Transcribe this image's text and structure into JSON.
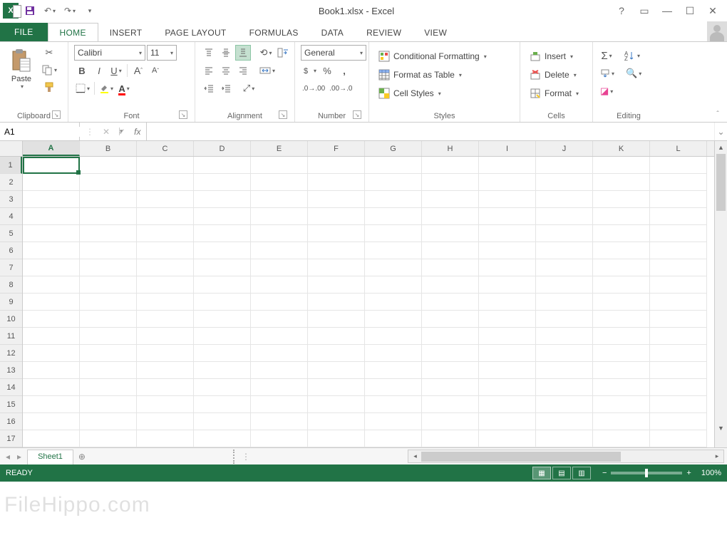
{
  "title": "Book1.xlsx - Excel",
  "tabs": {
    "file": "FILE",
    "home": "HOME",
    "insert": "INSERT",
    "pagelayout": "PAGE LAYOUT",
    "formulas": "FORMULAS",
    "data": "DATA",
    "review": "REVIEW",
    "view": "VIEW"
  },
  "ribbon": {
    "clipboard": {
      "paste": "Paste",
      "label": "Clipboard"
    },
    "font": {
      "name": "Calibri",
      "size": "11",
      "label": "Font"
    },
    "alignment": {
      "label": "Alignment"
    },
    "number": {
      "format": "General",
      "label": "Number"
    },
    "styles": {
      "cond": "Conditional Formatting",
      "table": "Format as Table",
      "cell": "Cell Styles",
      "label": "Styles"
    },
    "cells": {
      "insert": "Insert",
      "delete": "Delete",
      "format": "Format",
      "label": "Cells"
    },
    "editing": {
      "label": "Editing"
    }
  },
  "namebox": "A1",
  "fx": "fx",
  "columns": [
    "A",
    "B",
    "C",
    "D",
    "E",
    "F",
    "G",
    "H",
    "I",
    "J",
    "K",
    "L"
  ],
  "rows": [
    "1",
    "2",
    "3",
    "4",
    "5",
    "6",
    "7",
    "8",
    "9",
    "10",
    "11",
    "12",
    "13",
    "14",
    "15",
    "16",
    "17"
  ],
  "sheet": "Sheet1",
  "status": "READY",
  "zoom": "100%",
  "watermark": "FileHippo.com"
}
